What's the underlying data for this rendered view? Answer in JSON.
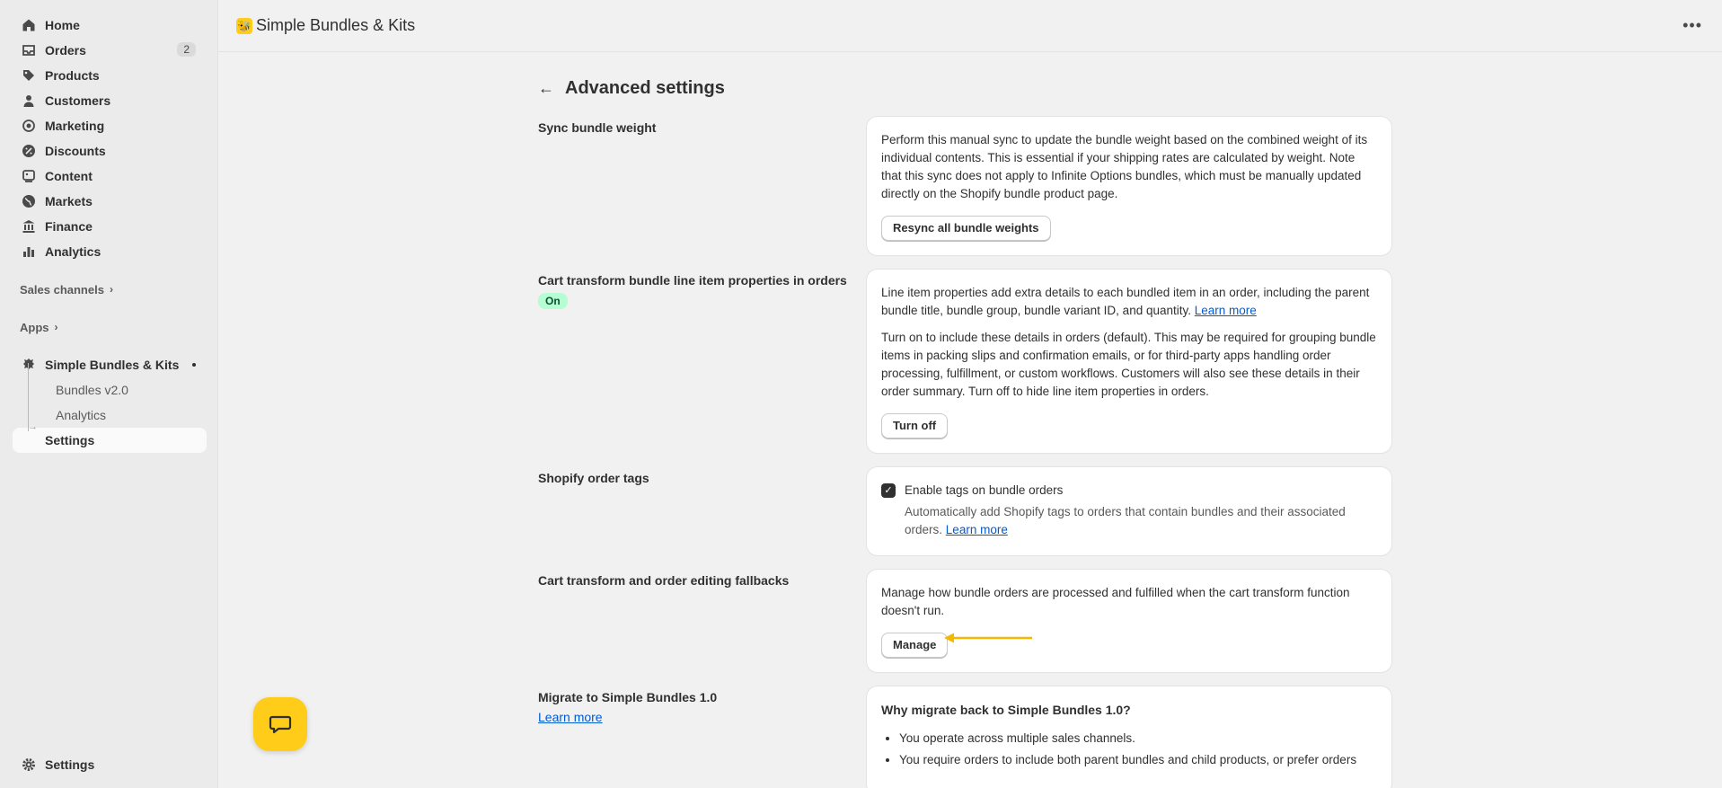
{
  "sidebar": {
    "items": [
      {
        "label": "Home",
        "icon": "home-icon"
      },
      {
        "label": "Orders",
        "icon": "inbox-icon",
        "badge": "2"
      },
      {
        "label": "Products",
        "icon": "tag-icon"
      },
      {
        "label": "Customers",
        "icon": "person-icon"
      },
      {
        "label": "Marketing",
        "icon": "target-icon"
      },
      {
        "label": "Discounts",
        "icon": "discount-icon"
      },
      {
        "label": "Content",
        "icon": "content-icon"
      },
      {
        "label": "Markets",
        "icon": "globe-icon"
      },
      {
        "label": "Finance",
        "icon": "bank-icon"
      },
      {
        "label": "Analytics",
        "icon": "bar-chart-icon"
      }
    ],
    "sales_channels": "Sales channels",
    "apps": "Apps",
    "app_name": "Simple Bundles & Kits",
    "app_sub_items": [
      "Bundles v2.0",
      "Analytics",
      "Settings"
    ],
    "settings": "Settings"
  },
  "topbar": {
    "title": "Simple Bundles & Kits"
  },
  "page": {
    "title": "Advanced settings",
    "sections": {
      "sync": {
        "label": "Sync bundle weight",
        "text": "Perform this manual sync to update the bundle weight based on the combined weight of its individual contents. This is essential if your shipping rates are calculated by weight. Note that this sync does not apply to Infinite Options bundles, which must be manually updated directly on the Shopify bundle product page.",
        "button": "Resync all bundle weights"
      },
      "cart_props": {
        "label": "Cart transform bundle line item properties in orders",
        "status": "On",
        "text1": "Line item properties add extra details to each bundled item in an order, including the parent bundle title, bundle group, bundle variant ID, and quantity.",
        "text1_link": "Learn more",
        "text2": "Turn on to include these details in orders (default). This may be required for grouping bundle items in packing slips and confirmation emails, or for third-party apps handling order processing, fulfillment, or custom workflows. Customers will also see these details in their order summary. Turn off to hide line item properties in orders.",
        "button": "Turn off"
      },
      "tags": {
        "label": "Shopify order tags",
        "checkbox_label": "Enable tags on bundle orders",
        "checked": true,
        "help": "Automatically add Shopify tags to orders that contain bundles and their associated orders.",
        "help_link": "Learn more"
      },
      "fallbacks": {
        "label": "Cart transform and order editing fallbacks",
        "text": "Manage how bundle orders are processed and fulfilled when the cart transform function doesn't run.",
        "button": "Manage"
      },
      "migrate": {
        "label": "Migrate to Simple Bundles 1.0",
        "link": "Learn more",
        "heading": "Why migrate back to Simple Bundles 1.0?",
        "bullets": [
          "You operate across multiple sales channels.",
          "You require orders to include both parent bundles and child products, or prefer orders"
        ]
      }
    }
  },
  "colors": {
    "accent_arrow": "#f5b800",
    "chat_bubble": "#ffcc1a",
    "link": "#005bd3"
  }
}
